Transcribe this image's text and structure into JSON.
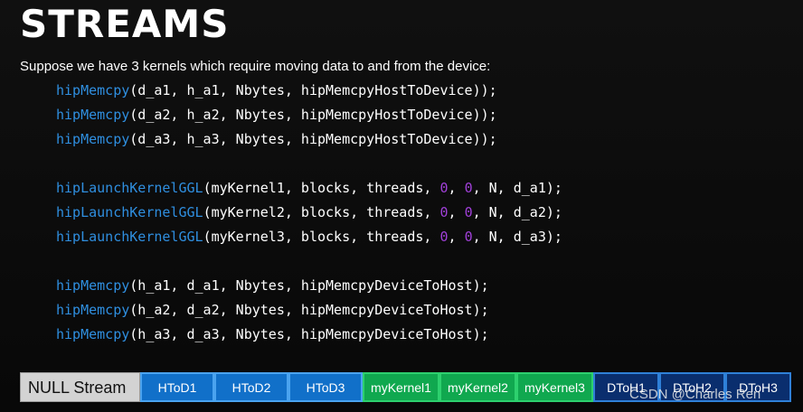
{
  "title": "STREAMS",
  "subtitle": "Suppose we have 3 kernels which require moving data to and from the device:",
  "code": {
    "memcpy_h2d": [
      {
        "fn": "hipMemcpy",
        "args": "(d_a1, h_a1, Nbytes, hipMemcpyHostToDevice));"
      },
      {
        "fn": "hipMemcpy",
        "args": "(d_a2, h_a2, Nbytes, hipMemcpyHostToDevice));"
      },
      {
        "fn": "hipMemcpy",
        "args": "(d_a3, h_a3, Nbytes, hipMemcpyHostToDevice));"
      }
    ],
    "launches": [
      {
        "fn": "hipLaunchKernelGGL",
        "pre": "(myKernel1, blocks, threads, ",
        "n1": "0",
        "sep": ", ",
        "n2": "0",
        "post": ", N, d_a1);"
      },
      {
        "fn": "hipLaunchKernelGGL",
        "pre": "(myKernel2, blocks, threads, ",
        "n1": "0",
        "sep": ", ",
        "n2": "0",
        "post": ", N, d_a2);"
      },
      {
        "fn": "hipLaunchKernelGGL",
        "pre": "(myKernel3, blocks, threads, ",
        "n1": "0",
        "sep": ", ",
        "n2": "0",
        "post": ", N, d_a3);"
      }
    ],
    "memcpy_d2h": [
      {
        "fn": "hipMemcpy",
        "args": "(h_a1, d_a1, Nbytes, hipMemcpyDeviceToHost);"
      },
      {
        "fn": "hipMemcpy",
        "args": "(h_a2, d_a2, Nbytes, hipMemcpyDeviceToHost);"
      },
      {
        "fn": "hipMemcpy",
        "args": "(h_a3, d_a3, Nbytes, hipMemcpyDeviceToHost);"
      }
    ]
  },
  "stream": {
    "label": "NULL Stream",
    "blocks": [
      {
        "text": "HToD1",
        "kind": "htod"
      },
      {
        "text": "HToD2",
        "kind": "htod"
      },
      {
        "text": "HToD3",
        "kind": "htod"
      },
      {
        "text": "myKernel1",
        "kind": "kernel"
      },
      {
        "text": "myKernel2",
        "kind": "kernel"
      },
      {
        "text": "myKernel3",
        "kind": "kernel"
      },
      {
        "text": "DToH1",
        "kind": "dtoh"
      },
      {
        "text": "DToH2",
        "kind": "dtoh"
      },
      {
        "text": "DToH3",
        "kind": "dtoh"
      }
    ]
  },
  "watermark": "CSDN @Charles Ren",
  "colors": {
    "function": "#2f8fe0",
    "number": "#a040d8",
    "htod": "#1170c9",
    "kernel": "#10a84f",
    "dtoh": "#0a2e6e",
    "null_stream": "#d3d3d3"
  }
}
